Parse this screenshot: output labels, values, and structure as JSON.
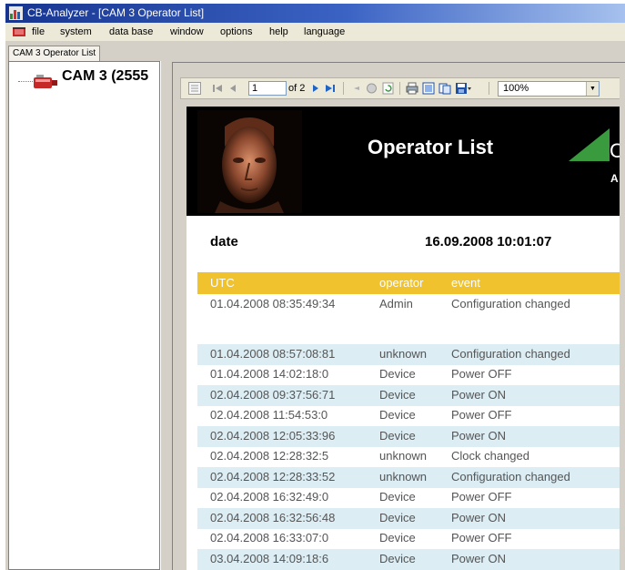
{
  "window": {
    "title": "CB-Analyzer - [CAM 3 Operator List]"
  },
  "menu": {
    "items": [
      "file",
      "system",
      "data base",
      "window",
      "options",
      "help",
      "language"
    ]
  },
  "tabs": [
    {
      "label": "CAM 3 Operator List"
    }
  ],
  "tree": {
    "root_label": "CAM 3 (2555"
  },
  "toolbar": {
    "page_value": "1",
    "page_total_label": "of 2",
    "zoom_value": "100%",
    "icons": [
      "toggle-tree-icon",
      "first-page-icon",
      "previous-page-icon",
      "next-page-icon",
      "last-page-icon",
      "back-icon",
      "stop-icon",
      "refresh-icon",
      "print-icon",
      "print-layout-icon",
      "page-setup-icon",
      "export-icon"
    ]
  },
  "report": {
    "title": "Operator List",
    "logo_letter": "C",
    "logo_sub": "A",
    "date_label": "date",
    "date_value": "16.09.2008 10:01:07",
    "colors": {
      "header_bg": "#000000",
      "column_header_bg": "#f0c22e",
      "alt_row_bg": "#dcedf4",
      "logo_green": "#3a9b3e"
    },
    "columns": [
      "UTC",
      "operator",
      "event"
    ],
    "rows": [
      {
        "utc": "01.04.2008 08:35:49:34",
        "operator": "Admin",
        "event": "Configuration changed"
      },
      {
        "utc": "01.04.2008 08:57:08:81",
        "operator": "unknown",
        "event": "Configuration changed"
      },
      {
        "utc": "01.04.2008 14:02:18:0",
        "operator": "Device",
        "event": "Power OFF"
      },
      {
        "utc": "02.04.2008 09:37:56:71",
        "operator": "Device",
        "event": "Power ON"
      },
      {
        "utc": "02.04.2008 11:54:53:0",
        "operator": "Device",
        "event": "Power OFF"
      },
      {
        "utc": "02.04.2008 12:05:33:96",
        "operator": "Device",
        "event": "Power ON"
      },
      {
        "utc": "02.04.2008 12:28:32:5",
        "operator": "unknown",
        "event": "Clock changed"
      },
      {
        "utc": "02.04.2008 12:28:33:52",
        "operator": "unknown",
        "event": "Configuration changed"
      },
      {
        "utc": "02.04.2008 16:32:49:0",
        "operator": "Device",
        "event": "Power OFF"
      },
      {
        "utc": "02.04.2008 16:32:56:48",
        "operator": "Device",
        "event": "Power ON"
      },
      {
        "utc": "02.04.2008 16:33:07:0",
        "operator": "Device",
        "event": "Power OFF"
      },
      {
        "utc": "03.04.2008 14:09:18:6",
        "operator": "Device",
        "event": "Power ON"
      }
    ]
  }
}
